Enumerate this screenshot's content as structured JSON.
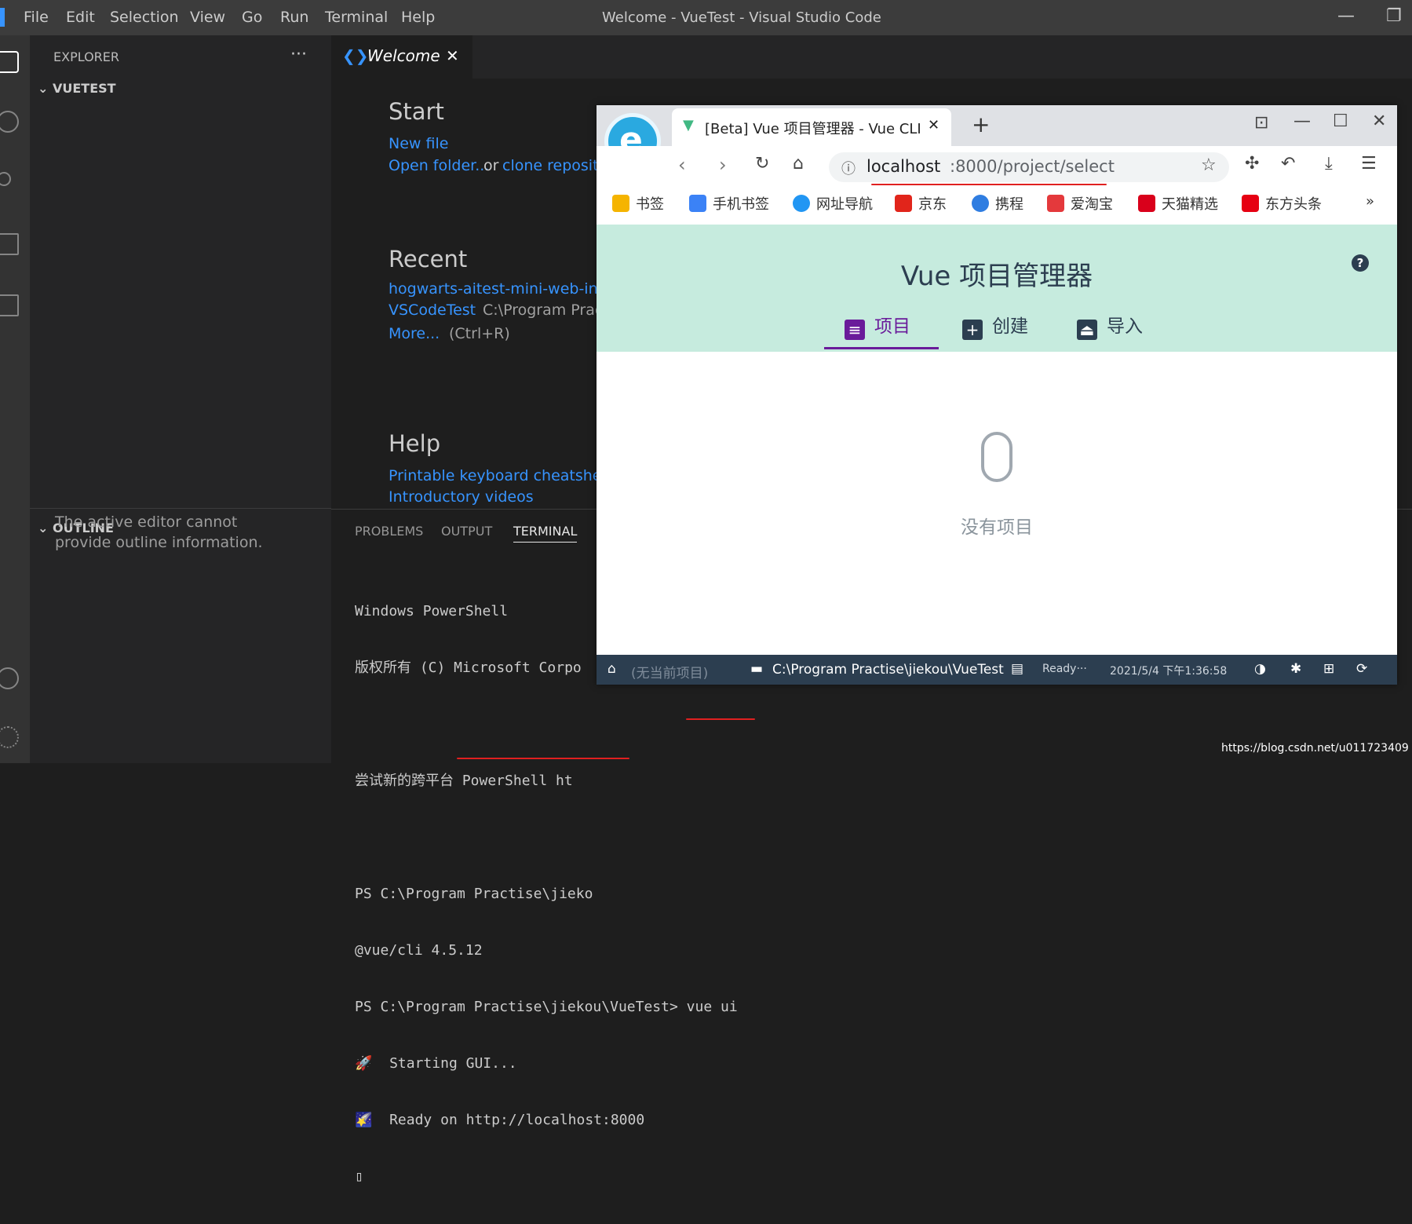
{
  "window": {
    "title": "Welcome - VueTest - Visual Studio Code",
    "menu": [
      "File",
      "Edit",
      "Selection",
      "View",
      "Go",
      "Run",
      "Terminal",
      "Help"
    ],
    "minimize": "—",
    "maximize": "❐"
  },
  "sidebar": {
    "header": "EXPLORER",
    "more": "···",
    "folder": "VUETEST",
    "outline": "OUTLINE",
    "outline_msg": "The active editor cannot provide outline information."
  },
  "editor": {
    "tab_label": "Welcome",
    "tab_close": "✕",
    "start_heading": "Start",
    "new_file": "New file",
    "open_folder": "Open folder...",
    "or": "or",
    "clone_repo": "clone reposito",
    "recent_heading": "Recent",
    "recent": [
      {
        "name": "hogwarts-aitest-mini-web-ing",
        "path": ""
      },
      {
        "name": "VSCodeTest",
        "path": "C:\\Program Pract"
      }
    ],
    "more": "More...",
    "more_shortcut": "(Ctrl+R)",
    "help_heading": "Help",
    "help_links": [
      "Printable keyboard cheatsheet",
      "Introductory videos"
    ]
  },
  "panel": {
    "tabs": [
      "PROBLEMS",
      "OUTPUT",
      "TERMINAL"
    ],
    "active_tab": "TERMINAL",
    "terminal_lines": [
      "Windows PowerShell",
      "版权所有 (C) Microsoft Corpo",
      "",
      "尝试新的跨平台 PowerShell ht",
      "",
      "PS C:\\Program Practise\\jieko",
      "@vue/cli 4.5.12",
      "PS C:\\Program Practise\\jiekou\\VueTest> vue ui",
      "🚀  Starting GUI...",
      "🌠  Ready on http://localhost:8000",
      "▯"
    ]
  },
  "browser": {
    "tab_title": "[Beta] Vue 项目管理器 - Vue CLI",
    "tab_close": "✕",
    "new_tab": "+",
    "url_host": "localhost",
    "url_rest": ":8000/project/select",
    "bookmarks": [
      {
        "label": "书签",
        "color": "#f5b400"
      },
      {
        "label": "手机书签",
        "color": "#3b82f6"
      },
      {
        "label": "网址导航",
        "color": "#2196f3"
      },
      {
        "label": "京东",
        "color": "#e1251b"
      },
      {
        "label": "携程",
        "color": "#2f7de1"
      },
      {
        "label": "爱淘宝",
        "color": "#e4393c"
      },
      {
        "label": "天猫精选",
        "color": "#d9001b"
      },
      {
        "label": "东方头条",
        "color": "#e60012"
      }
    ],
    "bookmarks_more": "»",
    "app_title": "Vue 项目管理器",
    "help": "?",
    "nav": [
      {
        "label": "项目",
        "active": true
      },
      {
        "label": "创建",
        "active": false
      },
      {
        "label": "导入",
        "active": false
      }
    ],
    "empty": "没有项目",
    "status": {
      "no_project": "(无当前项目)",
      "path": "C:\\Program Practise\\jiekou\\VueTest",
      "ready": "Ready···",
      "datetime": "2021/5/4 下午1:36:58"
    }
  },
  "watermark": "https://blog.csdn.net/u011723409",
  "colors": {
    "accent": "#3794ff",
    "vue_green": "#c6ebde",
    "underline": "#e02020",
    "active_tab": "#6a1b9a"
  }
}
